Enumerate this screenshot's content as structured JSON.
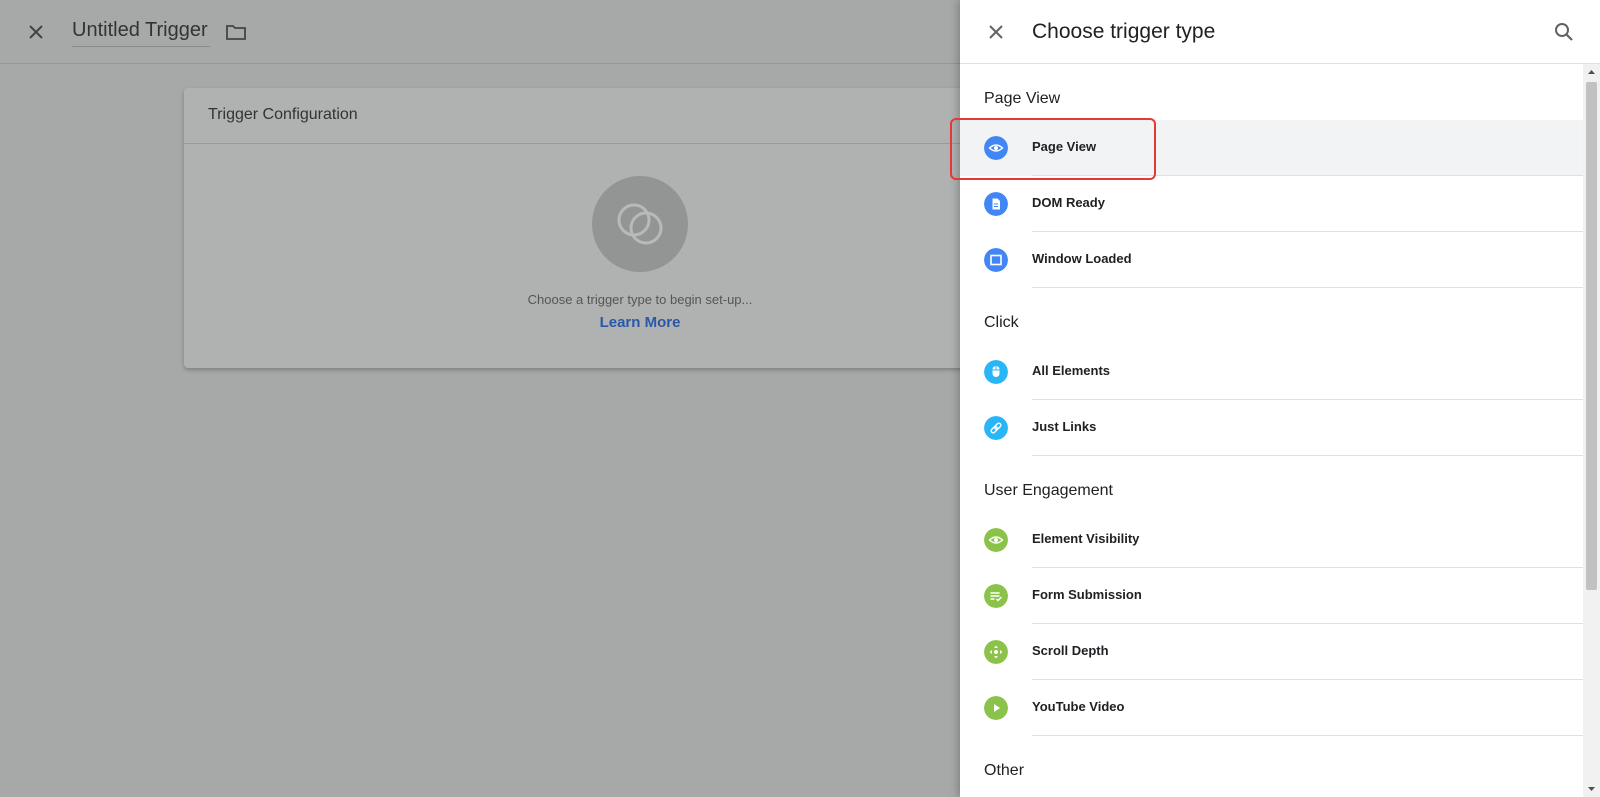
{
  "editor": {
    "title": "Untitled Trigger",
    "card_title": "Trigger Configuration",
    "hint": "Choose a trigger type to begin set-up...",
    "learn_more": "Learn More"
  },
  "panel": {
    "title": "Choose trigger type",
    "sections": [
      {
        "title": "Page View",
        "items": [
          {
            "label": "Page View",
            "icon": "eye-icon",
            "color": "#4285f4",
            "selected": true
          },
          {
            "label": "DOM Ready",
            "icon": "document-icon",
            "color": "#4285f4"
          },
          {
            "label": "Window Loaded",
            "icon": "window-icon",
            "color": "#4285f4"
          }
        ]
      },
      {
        "title": "Click",
        "items": [
          {
            "label": "All Elements",
            "icon": "mouse-icon",
            "color": "#29b6f6"
          },
          {
            "label": "Just Links",
            "icon": "link-icon",
            "color": "#29b6f6"
          }
        ]
      },
      {
        "title": "User Engagement",
        "items": [
          {
            "label": "Element Visibility",
            "icon": "eye-icon",
            "color": "#8bc34a"
          },
          {
            "label": "Form Submission",
            "icon": "form-icon",
            "color": "#8bc34a"
          },
          {
            "label": "Scroll Depth",
            "icon": "move-icon",
            "color": "#8bc34a"
          },
          {
            "label": "YouTube Video",
            "icon": "play-icon",
            "color": "#8bc34a"
          }
        ]
      },
      {
        "title": "Other",
        "items": []
      }
    ]
  },
  "colors": {
    "highlight": "#e53935",
    "link": "#2a58a8"
  }
}
